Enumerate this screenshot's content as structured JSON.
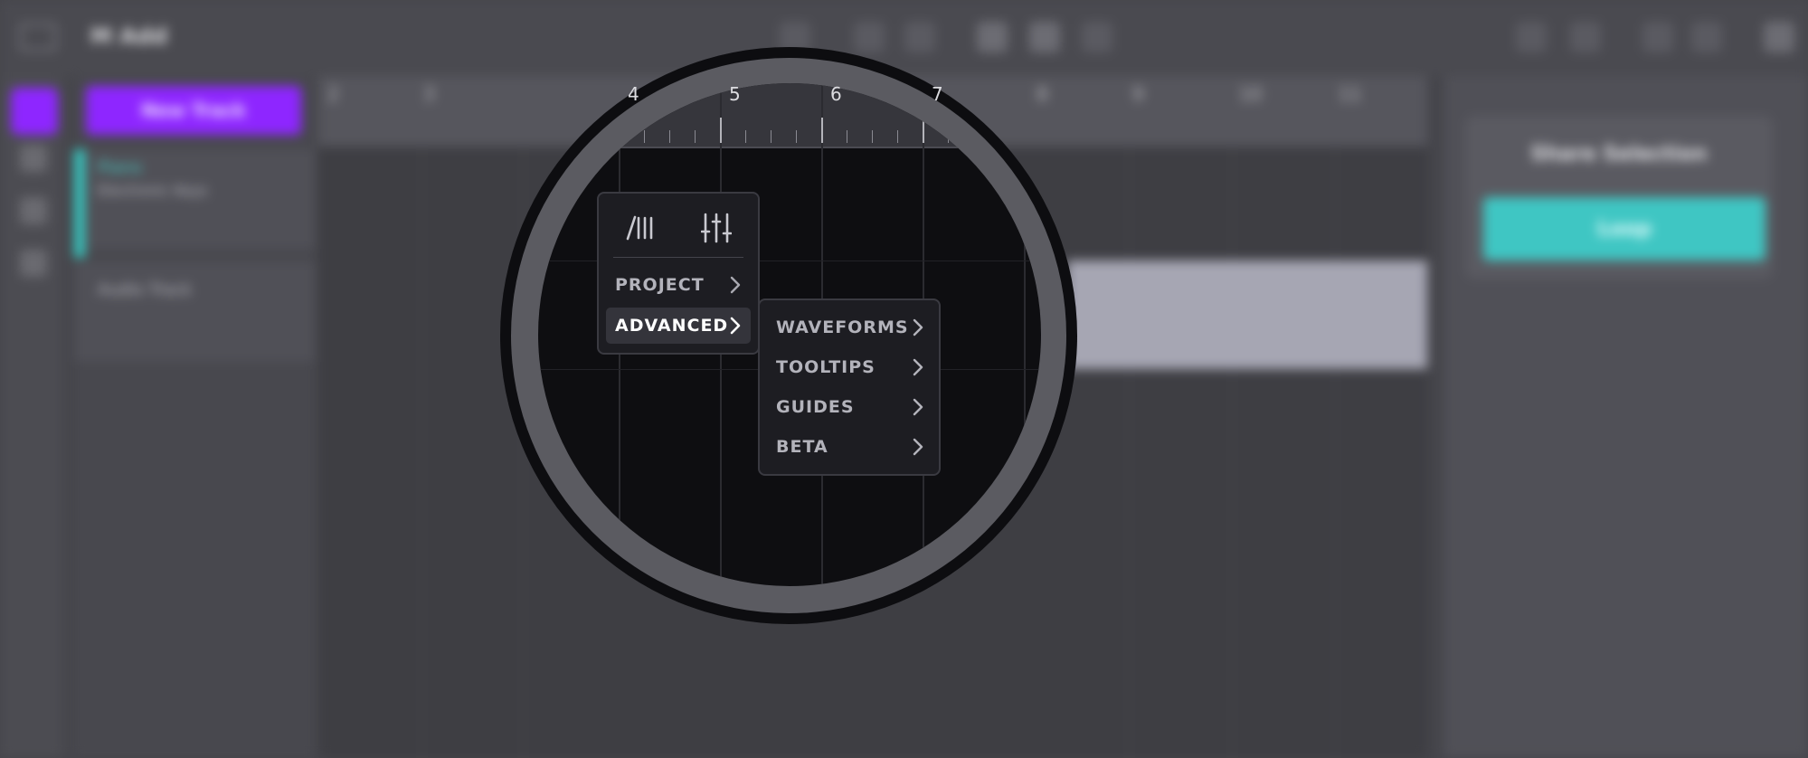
{
  "app": {
    "song_title": "M Add"
  },
  "sidebar": {
    "new_track_label": "New Track"
  },
  "tracks": [
    {
      "name": "Piano",
      "subtitle": "Electronic Keys"
    },
    {
      "name": "Audio Track",
      "subtitle": ""
    }
  ],
  "ruler": {
    "numbers": [
      "2",
      "3",
      "4",
      "5",
      "6",
      "7",
      "8",
      "9",
      "10",
      "11"
    ]
  },
  "right_panel": {
    "title": "Share Selection",
    "button_label": "Loop"
  },
  "menu": {
    "items": [
      {
        "label": "PROJECT"
      },
      {
        "label": "ADVANCED"
      }
    ],
    "submenu": [
      {
        "label": "WAVEFORMS"
      },
      {
        "label": "TOOLTIPS"
      },
      {
        "label": "GUIDES"
      },
      {
        "label": "BETA"
      }
    ]
  },
  "colors": {
    "accent_purple": "#8e26ff",
    "accent_teal": "#3fc6c3",
    "menu_bg": "#1d1d22"
  },
  "icons": {
    "menu_tab_1": "metronome-bars-icon",
    "menu_tab_2": "mixer-sliders-icon"
  }
}
